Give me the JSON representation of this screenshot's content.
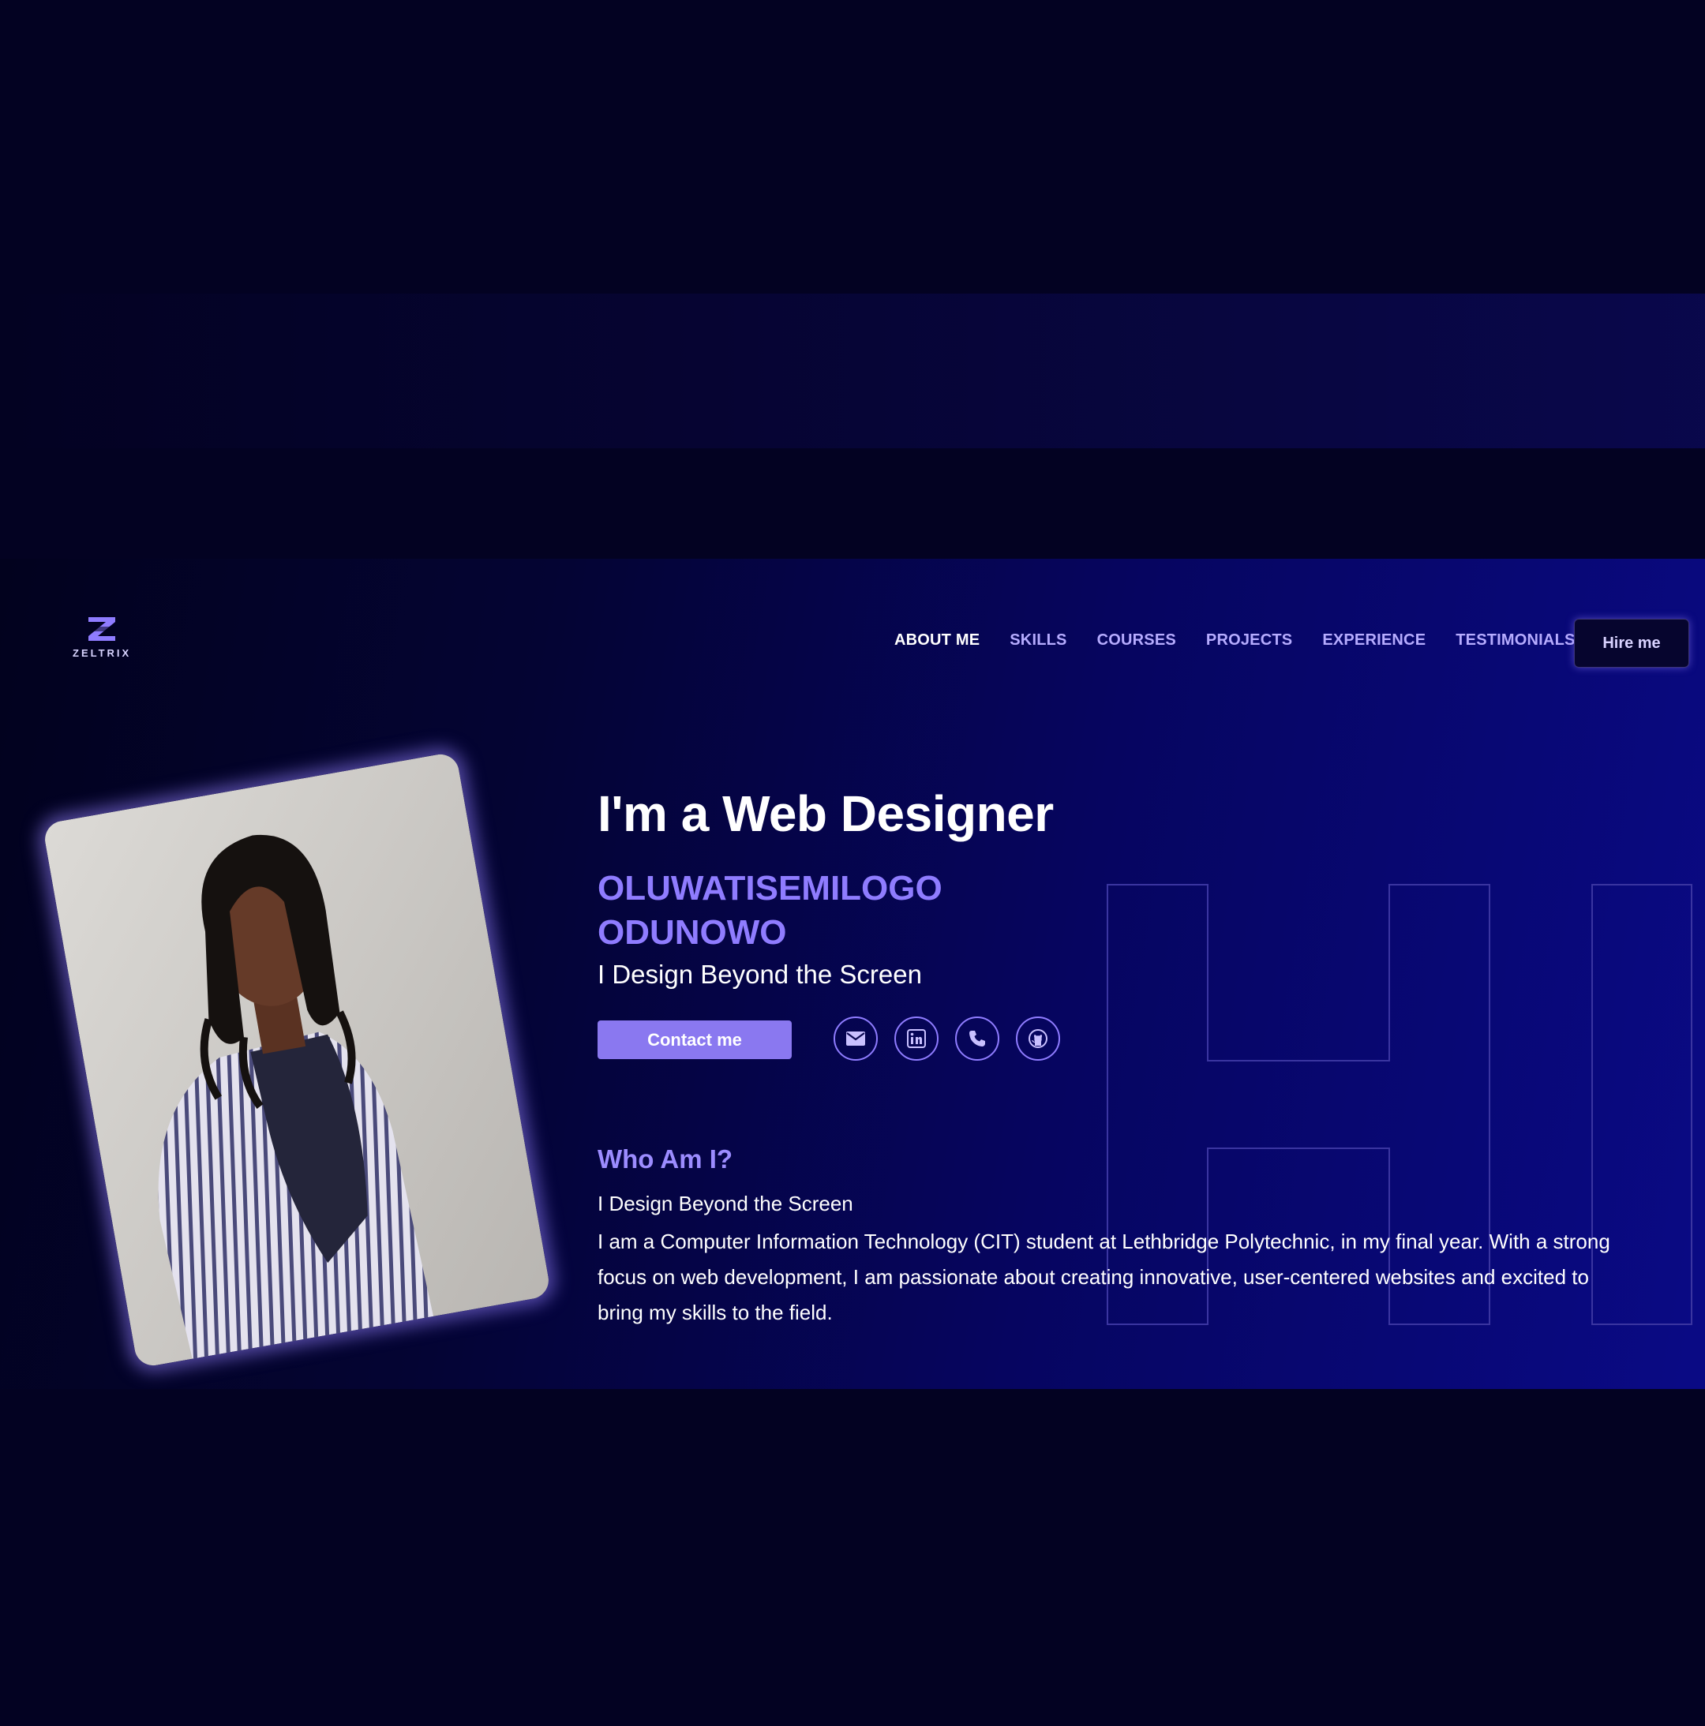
{
  "logo": {
    "text": "ZELTRIX"
  },
  "nav": {
    "items": [
      {
        "label": "ABOUT ME",
        "active": true
      },
      {
        "label": "SKILLS",
        "active": false
      },
      {
        "label": "COURSES",
        "active": false
      },
      {
        "label": "PROJECTS",
        "active": false
      },
      {
        "label": "EXPERIENCE",
        "active": false
      },
      {
        "label": "TESTIMONIALS",
        "active": false
      }
    ],
    "hire_label": "Hire me"
  },
  "hero": {
    "title": "I'm a Web Designer",
    "name_line1": "OLUWATISEMILOGO",
    "name_line2": "ODUNOWO",
    "tagline": "I Design Beyond the Screen",
    "contact_label": "Contact me",
    "socials": [
      {
        "icon": "email-icon"
      },
      {
        "icon": "linkedin-icon"
      },
      {
        "icon": "phone-icon"
      },
      {
        "icon": "github-icon"
      }
    ],
    "bg_letters": "HI"
  },
  "about": {
    "title": "Who Am I?",
    "line1": "I Design Beyond the Screen",
    "body": "I am a Computer Information Technology (CIT) student at Lethbridge Polytechnic, in my final year. With a strong focus on web development, I am passionate about creating innovative, user-centered websites and excited to bring my skills to the field."
  },
  "colors": {
    "accent": "#8a78f0",
    "name": "#8f7cff",
    "background": "#030222",
    "nav_text": "#b6acff"
  }
}
